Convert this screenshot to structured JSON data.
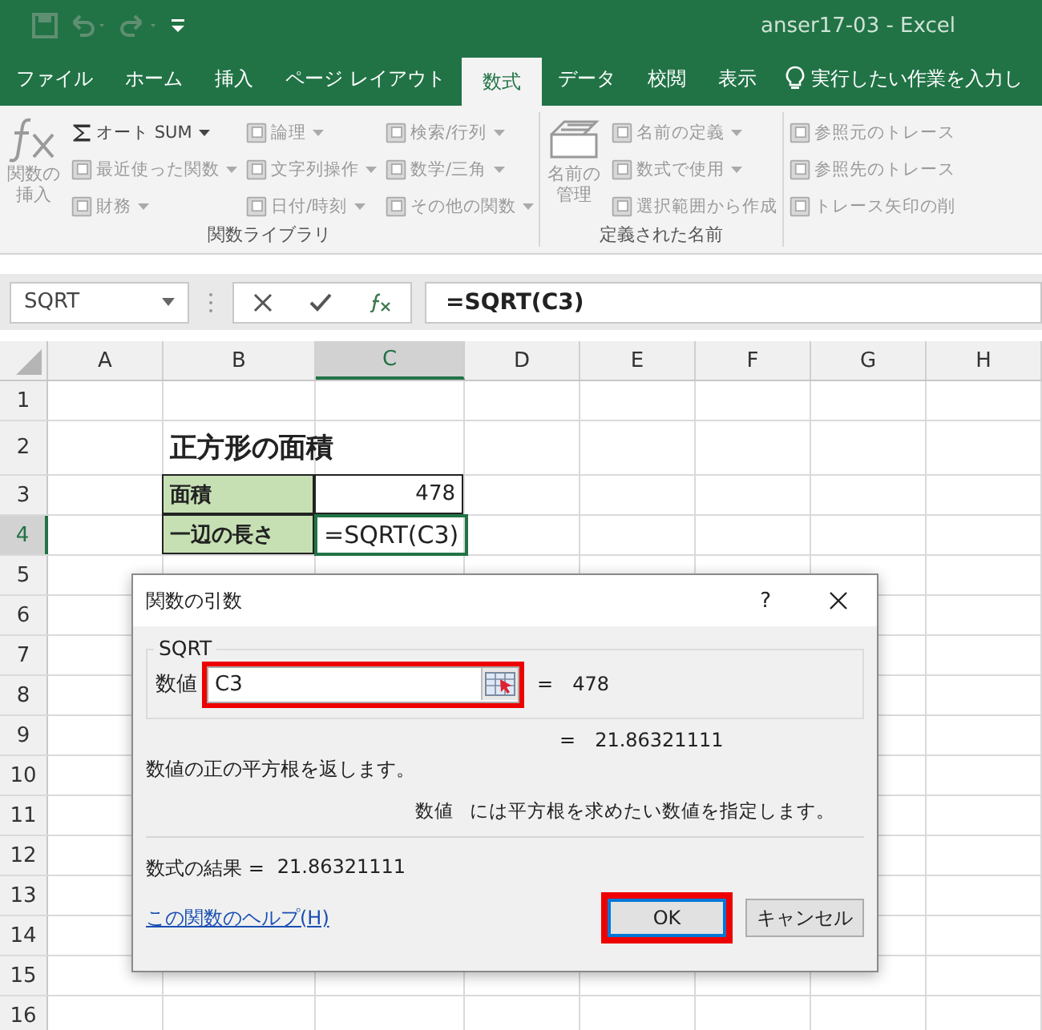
{
  "title_bar": {
    "title": "anser17-03  -  Excel"
  },
  "tabs": [
    {
      "label": "ファイル",
      "selected": false
    },
    {
      "label": "ホーム",
      "selected": false
    },
    {
      "label": "挿入",
      "selected": false
    },
    {
      "label": "ページ レイアウト",
      "selected": false
    },
    {
      "label": "数式",
      "selected": true
    },
    {
      "label": "データ",
      "selected": false
    },
    {
      "label": "校閲",
      "selected": false
    },
    {
      "label": "表示",
      "selected": false
    }
  ],
  "tell_me": {
    "text": "実行したい作業を入力し"
  },
  "ribbon": {
    "groups": [
      {
        "label": "関数ライブラリ",
        "large_button": {
          "label": "関数の挿入",
          "disabled": true
        },
        "columns": [
          [
            {
              "label": "オート SUM",
              "disabled": false,
              "has_menu": true
            },
            {
              "label": "最近使った関数",
              "disabled": true,
              "has_menu": true
            },
            {
              "label": "財務",
              "disabled": true,
              "has_menu": true
            }
          ],
          [
            {
              "label": "論理",
              "disabled": true,
              "has_menu": true
            },
            {
              "label": "文字列操作",
              "disabled": true,
              "has_menu": true
            },
            {
              "label": "日付/時刻",
              "disabled": true,
              "has_menu": true
            }
          ],
          [
            {
              "label": "検索/行列",
              "disabled": true,
              "has_menu": true
            },
            {
              "label": "数学/三角",
              "disabled": true,
              "has_menu": true
            },
            {
              "label": "その他の関数",
              "disabled": true,
              "has_menu": true
            }
          ]
        ]
      },
      {
        "label": "定義された名前",
        "large_button": {
          "label": "名前の管理",
          "disabled": true
        },
        "columns": [
          [
            {
              "label": "名前の定義",
              "disabled": true,
              "has_menu": true
            },
            {
              "label": "数式で使用",
              "disabled": true,
              "has_menu": true
            },
            {
              "label": "選択範囲から作成",
              "disabled": true,
              "has_menu": false
            }
          ]
        ]
      },
      {
        "columns": [
          [
            {
              "label": "参照元のトレース",
              "disabled": true,
              "has_menu": false
            },
            {
              "label": "参照先のトレース",
              "disabled": true,
              "has_menu": false
            },
            {
              "label": "トレース矢印の削",
              "disabled": true,
              "has_menu": false
            }
          ]
        ]
      }
    ]
  },
  "formula_bar": {
    "name_box": "SQRT",
    "formula": "=SQRT(C3)"
  },
  "sheet": {
    "columns": [
      {
        "label": "A",
        "selected": false
      },
      {
        "label": "B",
        "selected": false
      },
      {
        "label": "C",
        "selected": true
      },
      {
        "label": "D",
        "selected": false
      },
      {
        "label": "E",
        "selected": false
      },
      {
        "label": "F",
        "selected": false
      },
      {
        "label": "G",
        "selected": false
      },
      {
        "label": "H",
        "selected": false
      }
    ],
    "rows": [
      {
        "header": "1",
        "selected": false,
        "cells": []
      },
      {
        "header": "2",
        "selected": false,
        "cells": [
          null,
          {
            "text": "正方形の面積",
            "kind": "title"
          }
        ]
      },
      {
        "header": "3",
        "selected": false,
        "cells": [
          null,
          {
            "text": "面積",
            "kind": "label"
          },
          {
            "text": "478",
            "kind": "number"
          }
        ]
      },
      {
        "header": "4",
        "selected": true,
        "cells": [
          null,
          {
            "text": "一辺の長さ",
            "kind": "label"
          },
          {
            "text": "=SQRT(C3)",
            "kind": "editing"
          }
        ]
      },
      {
        "header": "5",
        "selected": false,
        "cells": []
      },
      {
        "header": "6",
        "selected": false,
        "cells": []
      },
      {
        "header": "7",
        "selected": false,
        "cells": []
      },
      {
        "header": "8",
        "selected": false,
        "cells": []
      },
      {
        "header": "9",
        "selected": false,
        "cells": []
      },
      {
        "header": "10",
        "selected": false,
        "cells": []
      },
      {
        "header": "11",
        "selected": false,
        "cells": []
      },
      {
        "header": "12",
        "selected": false,
        "cells": []
      },
      {
        "header": "13",
        "selected": false,
        "cells": []
      },
      {
        "header": "14",
        "selected": false,
        "cells": []
      },
      {
        "header": "15",
        "selected": false,
        "cells": []
      },
      {
        "header": "16",
        "selected": false,
        "cells": []
      }
    ]
  },
  "dialog": {
    "title": "関数の引数",
    "help_button": "?",
    "function_name": "SQRT",
    "argument": {
      "label": "数値",
      "value": "C3",
      "highlighted": true,
      "equals": "=",
      "result": "478"
    },
    "total": {
      "equals": "=",
      "value": "21.86321111"
    },
    "description": "数値の正の平方根を返します。",
    "argument_help": {
      "name": "数値",
      "text": "には平方根を求めたい数値を指定します。"
    },
    "formula_result": {
      "label": "数式の結果 =",
      "value": "21.86321111"
    },
    "help_link": "この関数のヘルプ(H)",
    "buttons": [
      {
        "label": "OK",
        "default": true,
        "highlighted": true
      },
      {
        "label": "キャンセル",
        "default": false,
        "highlighted": false
      }
    ]
  }
}
